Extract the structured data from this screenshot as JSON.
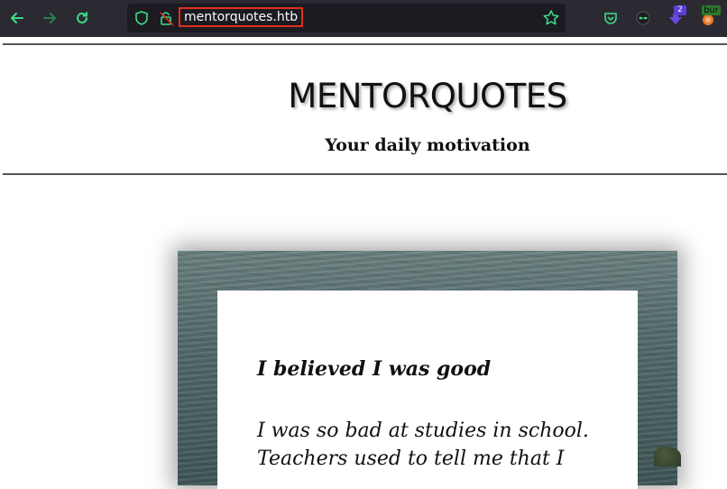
{
  "browser": {
    "url": "mentorquotes.htb",
    "extension_badge_count": "2",
    "extension_label": "bur"
  },
  "header": {
    "site_title": "MENTORQUOTES",
    "tagline": "Your daily motivation"
  },
  "quote": {
    "title": "I believed I was good",
    "body_line1": "I was so bad at studies in school.",
    "body_line2": "Teachers used to tell me that I"
  }
}
